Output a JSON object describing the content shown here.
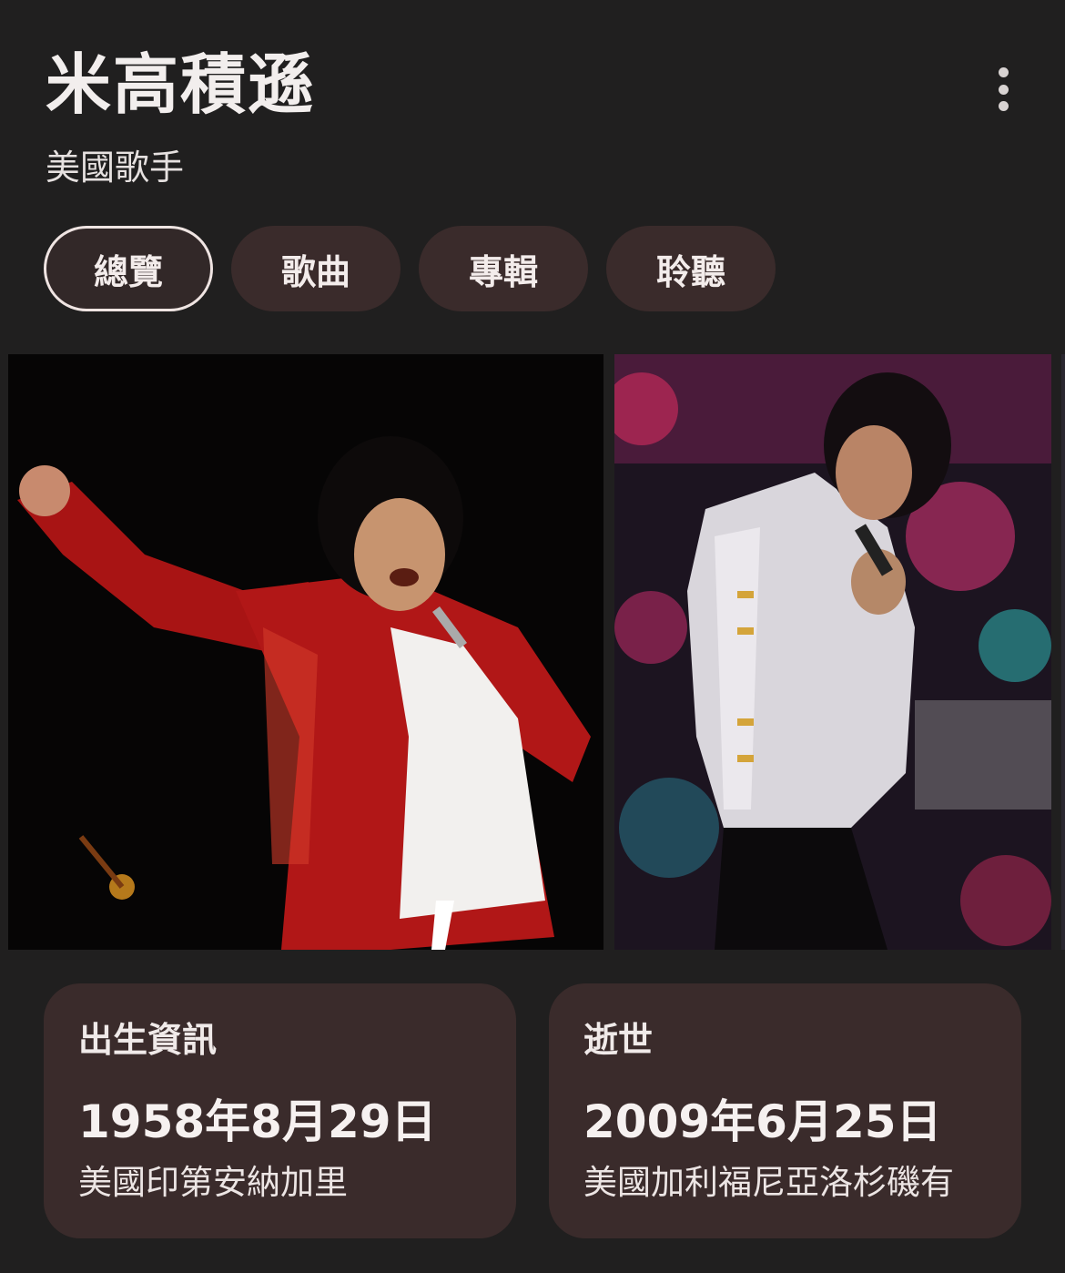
{
  "header": {
    "title": "米高積遜",
    "subtitle": "美國歌手",
    "more_icon": "more-vert-icon"
  },
  "tabs": [
    {
      "label": "總覽",
      "active": true
    },
    {
      "label": "歌曲",
      "active": false
    },
    {
      "label": "專輯",
      "active": false
    },
    {
      "label": "聆聽",
      "active": false
    }
  ],
  "images": [
    {
      "subject": "performer in red jacket on dark stage"
    },
    {
      "subject": "performer in white sequined jacket on colorful stage"
    }
  ],
  "facts": [
    {
      "label": "出生資訊",
      "value": "1958年8月29日",
      "detail": "美國印第安納加里"
    },
    {
      "label": "逝世",
      "value": "2009年6月25日",
      "detail": "美國加利福尼亞洛杉磯有"
    }
  ],
  "colors": {
    "background": "#201f1f",
    "chip": "#3a2b2b",
    "card": "#3a2b2b",
    "text": "#f2eeed"
  }
}
